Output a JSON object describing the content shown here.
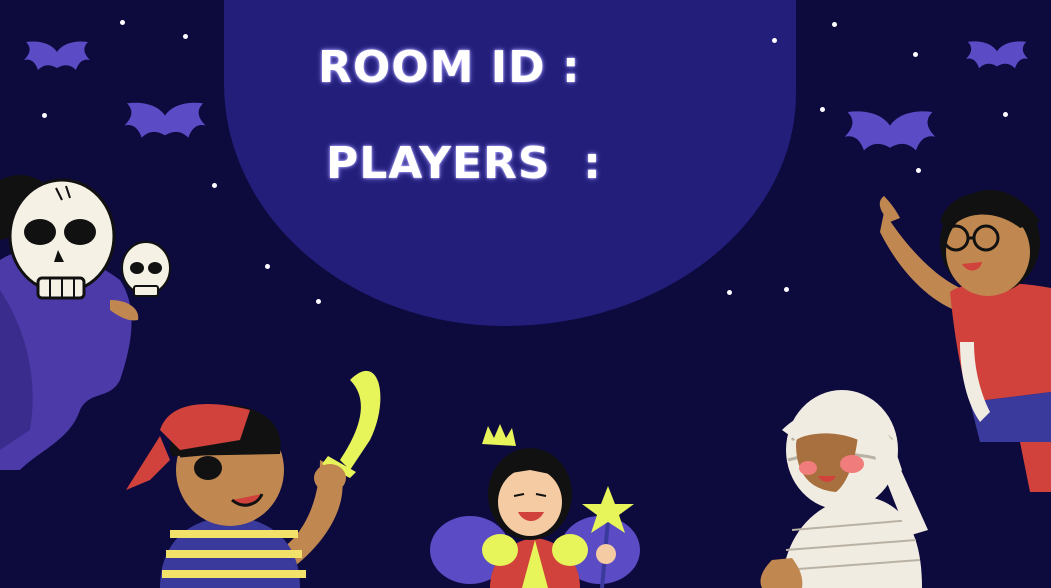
{
  "room": {
    "id_label": "ROOM ID :",
    "players_label": "PLAYERS  :"
  },
  "colors": {
    "background": "#0d0a3e",
    "panel": "#221e7a",
    "bat": "#5b4bc4",
    "text": "#ffffff"
  },
  "icons": {
    "bat": "bat-icon",
    "star": "star-icon",
    "skull": "skull-icon"
  }
}
